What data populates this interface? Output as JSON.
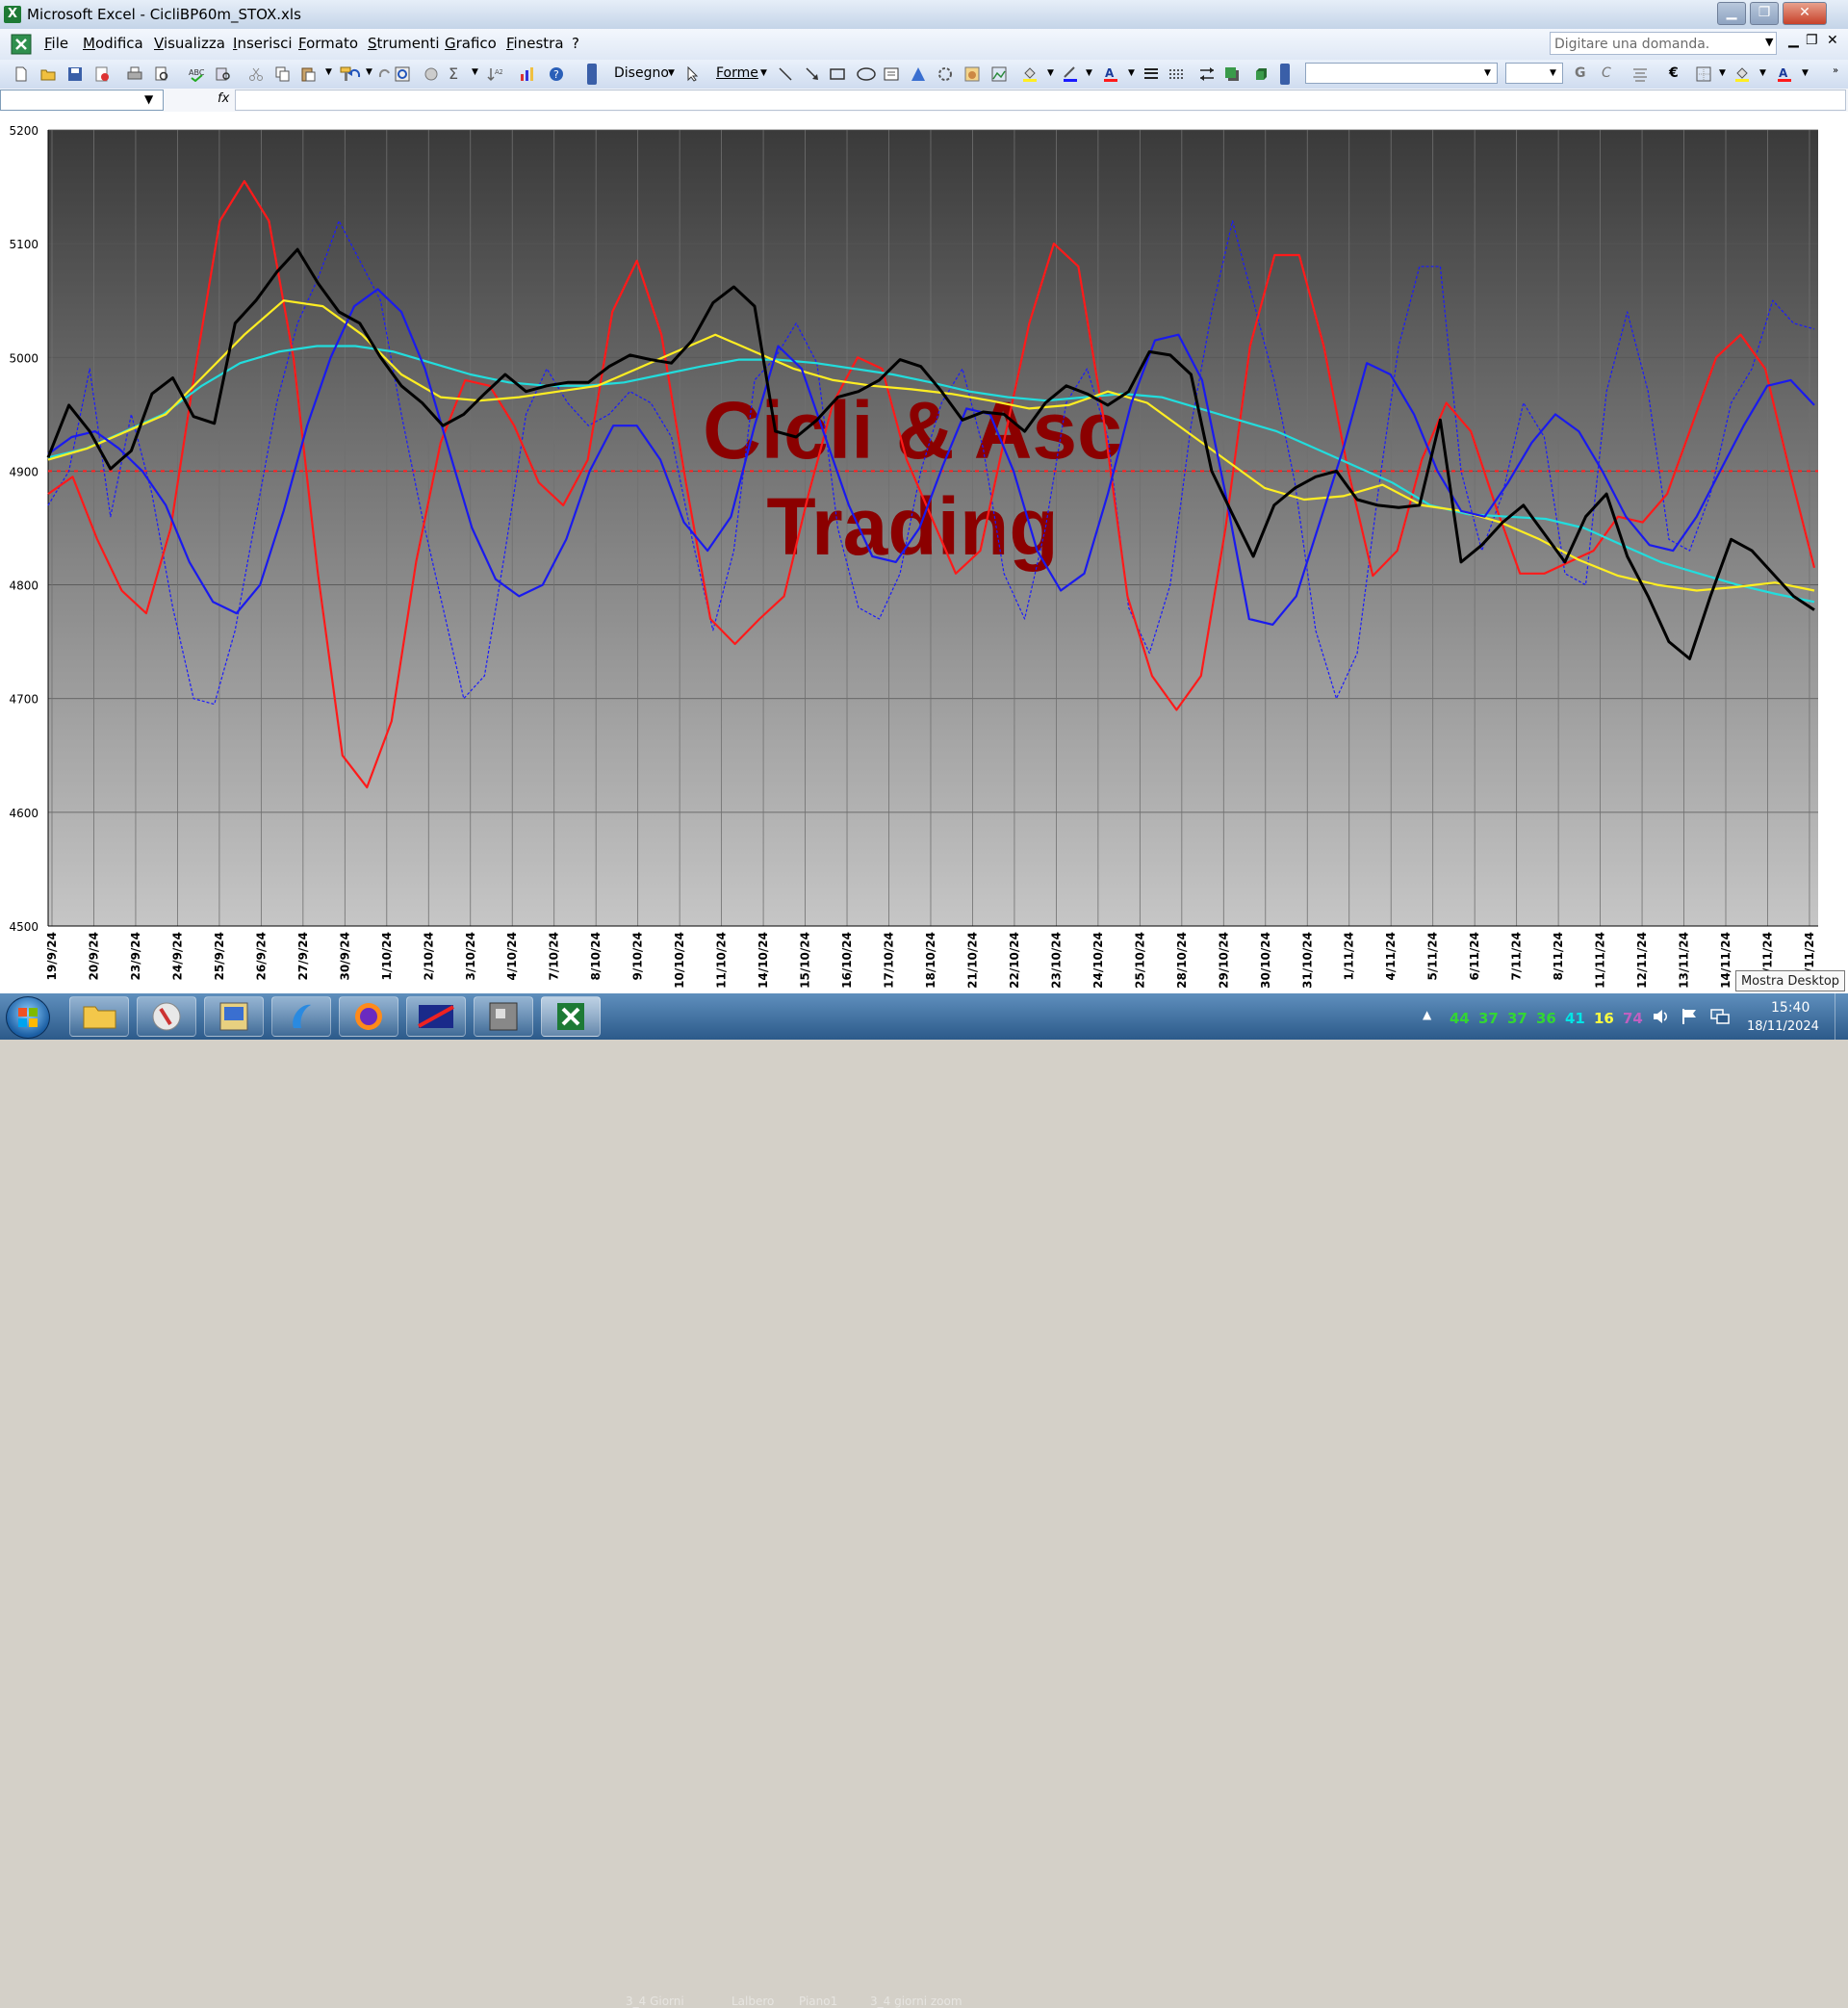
{
  "window": {
    "title": "Microsoft Excel - CicliBP60m_STOX.xls",
    "icon_letter": "X"
  },
  "menu": [
    "File",
    "Modifica",
    "Visualizza",
    "Inserisci",
    "Formato",
    "Strumenti",
    "Grafico",
    "Finestra",
    "?"
  ],
  "help_placeholder": "Digitare una domanda.",
  "toolbar": {
    "drawing_label": "Disegno",
    "shapes_label": "Forme",
    "bold": "G",
    "italic": "C",
    "euro": "€"
  },
  "formula": {
    "fx": "fx"
  },
  "watermark": {
    "line1": "Cicli & Asc",
    "line2": "Trading"
  },
  "taskbar": {
    "tray_numbers": [
      "44",
      "37",
      "37",
      "36",
      "41",
      "16",
      "74"
    ],
    "tray_colors": [
      "#33d633",
      "#33d633",
      "#33d633",
      "#33d633",
      "#00e5e5",
      "#ffff40",
      "#c060c0"
    ],
    "ghost_tabs": [
      "3_4 Giorni",
      "Lalbero",
      "Piano1",
      "3_4 giorni zoom"
    ],
    "time": "15:40",
    "date": "18/11/2024"
  },
  "tooltip": "Mostra Desktop",
  "chart_data": {
    "type": "line",
    "ylim": [
      4500,
      5200
    ],
    "yticks": [
      4500,
      4600,
      4700,
      4800,
      4900,
      5000,
      5100,
      5200
    ],
    "xlabels": [
      "19/9/24",
      "20/9/24",
      "23/9/24",
      "24/9/24",
      "25/9/24",
      "26/9/24",
      "27/9/24",
      "30/9/24",
      "1/10/24",
      "2/10/24",
      "3/10/24",
      "4/10/24",
      "7/10/24",
      "8/10/24",
      "9/10/24",
      "10/10/24",
      "11/10/24",
      "14/10/24",
      "15/10/24",
      "16/10/24",
      "17/10/24",
      "18/10/24",
      "21/10/24",
      "22/10/24",
      "23/10/24",
      "24/10/24",
      "25/10/24",
      "28/10/24",
      "29/10/24",
      "30/10/24",
      "31/10/24",
      "1/11/24",
      "4/11/24",
      "5/11/24",
      "6/11/24",
      "7/11/24",
      "8/11/24",
      "11/11/24",
      "12/11/24",
      "13/11/24",
      "14/11/24",
      "15/11/24",
      "18/11/24"
    ],
    "reference_line": 4900,
    "series": [
      {
        "color": "#000000",
        "style": "solid",
        "values": [
          4912,
          4958,
          4935,
          4902,
          4918,
          4968,
          4982,
          4948,
          4942,
          5030,
          5050,
          5075,
          5095,
          5065,
          5040,
          5030,
          5000,
          4975,
          4960,
          4940,
          4950,
          4968,
          4985,
          4970,
          4975,
          4978,
          4978,
          4992,
          5002,
          4998,
          4995,
          5015,
          5048,
          5062,
          5045,
          4935,
          4930,
          4945,
          4965,
          4970,
          4980,
          4998,
          4992,
          4970,
          4945,
          4952,
          4950,
          4935,
          4960,
          4975,
          4968,
          4958,
          4970,
          5005,
          5002,
          4985,
          4900,
          4862,
          4825,
          4870,
          4885,
          4895,
          4900,
          4875,
          4870,
          4868,
          4870,
          4945,
          4820,
          4835,
          4855,
          4870,
          4845,
          4820,
          4860,
          4880,
          4825,
          4790,
          4750,
          4735,
          4790,
          4840,
          4830,
          4810,
          4790,
          4778
        ]
      },
      {
        "color": "#1a1aff",
        "style": "dashed",
        "values": [
          4870,
          4900,
          4990,
          4860,
          4950,
          4880,
          4780,
          4700,
          4695,
          4760,
          4860,
          4960,
          5030,
          5070,
          5120,
          5085,
          5050,
          4950,
          4860,
          4780,
          4700,
          4720,
          4830,
          4950,
          4990,
          4960,
          4940,
          4950,
          4970,
          4960,
          4930,
          4840,
          4760,
          4830,
          4980,
          5000,
          5030,
          4995,
          4850,
          4780,
          4770,
          4810,
          4900,
          4960,
          4990,
          4920,
          4810,
          4770,
          4850,
          4960,
          4990,
          4930,
          4780,
          4740,
          4800,
          4940,
          5040,
          5120,
          5050,
          4980,
          4890,
          4760,
          4700,
          4740,
          4880,
          5010,
          5080,
          5080,
          4900,
          4830,
          4880,
          4960,
          4930,
          4810,
          4800,
          4970,
          5040,
          4970,
          4840,
          4830,
          4880,
          4960,
          4990,
          5050,
          5030,
          5025
        ]
      },
      {
        "color": "#ff1a1a",
        "style": "solid",
        "values": [
          4880,
          4895,
          4840,
          4795,
          4775,
          4850,
          4990,
          5120,
          5155,
          5120,
          5000,
          4810,
          4650,
          4622,
          4680,
          4820,
          4925,
          4980,
          4975,
          4940,
          4890,
          4870,
          4910,
          5040,
          5085,
          5020,
          4890,
          4770,
          4748,
          4770,
          4790,
          4880,
          4960,
          5000,
          4990,
          4910,
          4860,
          4810,
          4830,
          4930,
          5030,
          5100,
          5080,
          4950,
          4790,
          4720,
          4690,
          4720,
          4850,
          5010,
          5090,
          5090,
          5010,
          4900,
          4808,
          4830,
          4910,
          4960,
          4935,
          4870,
          4810,
          4810,
          4820,
          4830,
          4860,
          4855,
          4880,
          4940,
          5000,
          5020,
          4990,
          4900,
          4815
        ]
      },
      {
        "color": "#1a1aee",
        "style": "solid",
        "values": [
          4915,
          4930,
          4935,
          4920,
          4900,
          4870,
          4820,
          4785,
          4775,
          4800,
          4865,
          4940,
          5000,
          5045,
          5060,
          5040,
          4990,
          4920,
          4850,
          4805,
          4790,
          4800,
          4840,
          4900,
          4940,
          4940,
          4910,
          4855,
          4830,
          4860,
          4940,
          5010,
          4990,
          4930,
          4870,
          4825,
          4820,
          4850,
          4905,
          4955,
          4950,
          4900,
          4830,
          4795,
          4810,
          4880,
          4960,
          5015,
          5020,
          4980,
          4880,
          4770,
          4765,
          4790,
          4855,
          4920,
          4995,
          4985,
          4950,
          4900,
          4865,
          4860,
          4890,
          4925,
          4950,
          4935,
          4900,
          4860,
          4835,
          4830,
          4860,
          4900,
          4940,
          4975,
          4980,
          4958
        ]
      },
      {
        "color": "#22dddd",
        "style": "solid",
        "values": [
          4912,
          4920,
          4935,
          4950,
          4975,
          4995,
          5005,
          5010,
          5010,
          5005,
          4995,
          4985,
          4978,
          4975,
          4975,
          4978,
          4985,
          4992,
          4998,
          4998,
          4995,
          4990,
          4985,
          4978,
          4970,
          4965,
          4962,
          4965,
          4968,
          4965,
          4955,
          4945,
          4935,
          4920,
          4905,
          4890,
          4870,
          4862,
          4860,
          4858,
          4850,
          4835,
          4820,
          4810,
          4800,
          4792,
          4785
        ]
      },
      {
        "color": "#ffee22",
        "style": "solid",
        "values": [
          4910,
          4920,
          4935,
          4950,
          4985,
          5020,
          5050,
          5045,
          5020,
          4985,
          4965,
          4962,
          4965,
          4970,
          4975,
          4990,
          5005,
          5020,
          5005,
          4990,
          4980,
          4975,
          4972,
          4968,
          4962,
          4955,
          4958,
          4970,
          4960,
          4935,
          4910,
          4885,
          4875,
          4878,
          4888,
          4870,
          4865,
          4855,
          4840,
          4822,
          4808,
          4800,
          4795,
          4798,
          4802,
          4795
        ]
      }
    ]
  }
}
